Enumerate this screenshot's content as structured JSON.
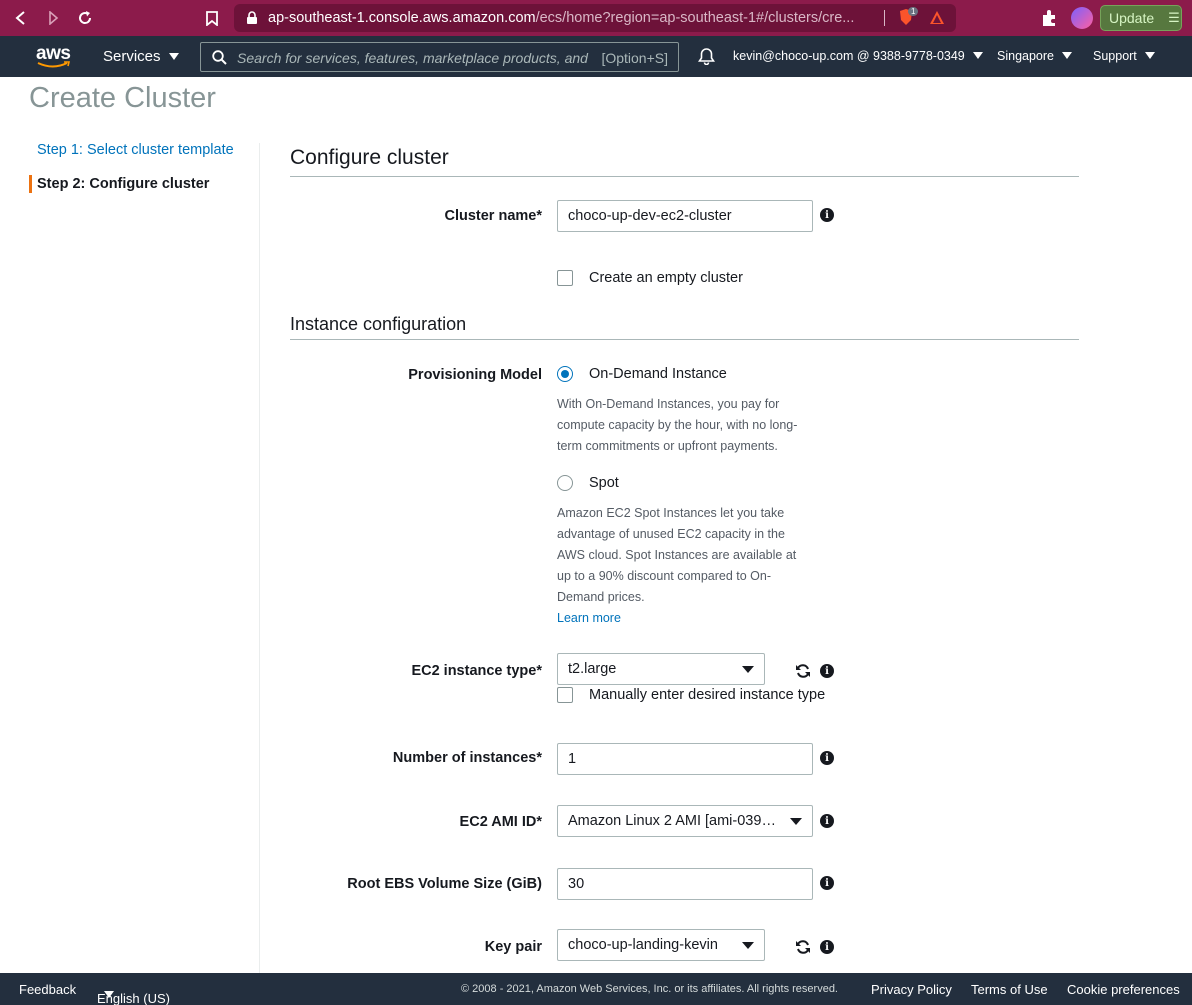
{
  "browser": {
    "url_main": "ap-southeast-1.console.aws.amazon.com",
    "url_path": "/ecs/home?region=ap-southeast-1#/clusters/cre...",
    "brave_badge": "1",
    "update_label": "Update"
  },
  "aws_nav": {
    "logo_text": "aws",
    "services_label": "Services",
    "search_placeholder": "Search for services, features, marketplace products, and",
    "search_shortcut": "[Option+S]",
    "account": "kevin@choco-up.com @ 9388-9778-0349",
    "region": "Singapore",
    "support": "Support"
  },
  "page": {
    "title": "Create Cluster",
    "steps": [
      {
        "label": "Step 1: Select cluster template"
      },
      {
        "label": "Step 2: Configure cluster"
      }
    ]
  },
  "configure": {
    "heading": "Configure cluster",
    "cluster_name_label": "Cluster name*",
    "cluster_name_value": "choco-up-dev-ec2-cluster",
    "empty_cluster_label": "Create an empty cluster"
  },
  "instance": {
    "heading": "Instance configuration",
    "provisioning_label": "Provisioning Model",
    "on_demand_label": "On-Demand Instance",
    "on_demand_help": "With On-Demand Instances, you pay for compute capacity by the hour, with no long-term commitments or upfront payments.",
    "spot_label": "Spot",
    "spot_help": "Amazon EC2 Spot Instances let you take advantage of unused EC2 capacity in the AWS cloud. Spot Instances are available at up to a 90% discount compared to On-Demand prices.",
    "learn_more": "Learn more",
    "instance_type_label": "EC2 instance type*",
    "instance_type_value": "t2.large",
    "manual_type_label": "Manually enter desired instance type",
    "num_instances_label": "Number of instances*",
    "num_instances_value": "1",
    "ami_label": "EC2 AMI ID*",
    "ami_value": "Amazon Linux 2 AMI [ami-039e...",
    "ebs_label": "Root EBS Volume Size (GiB)",
    "ebs_value": "30",
    "key_pair_label": "Key pair",
    "key_pair_value": "choco-up-landing-kevin"
  },
  "footer": {
    "feedback": "Feedback",
    "language": "English (US)",
    "copyright": "© 2008 - 2021, Amazon Web Services, Inc. or its affiliates. All rights reserved.",
    "privacy": "Privacy Policy",
    "terms": "Terms of Use",
    "cookies": "Cookie preferences"
  },
  "colors": {
    "browser_bar": "#8c1b4b",
    "aws_nav": "#232f3e",
    "link": "#0073bb",
    "active_step": "#ec7211"
  }
}
